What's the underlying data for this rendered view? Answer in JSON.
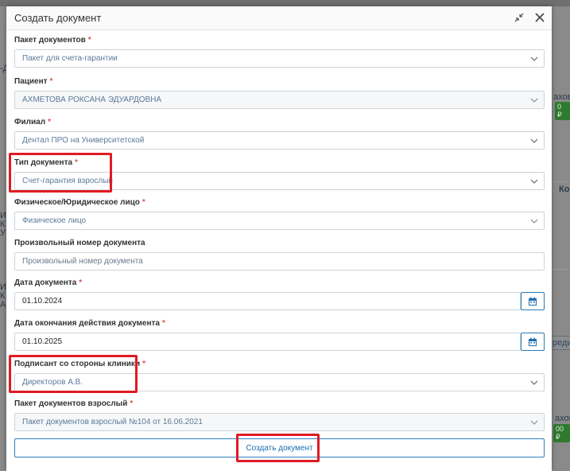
{
  "modal": {
    "title": "Создать документ"
  },
  "fields": {
    "doc_package": {
      "label": "Пакет документов",
      "value": "Пакет для счета-гарантии"
    },
    "patient": {
      "label": "Пациент",
      "value": "АХМЕТОВА РОКСАНА ЭДУАРДОВНА"
    },
    "branch": {
      "label": "Филиал",
      "value": "Дентал ПРО на Университетской"
    },
    "doc_type": {
      "label": "Тип документа",
      "value": "Счет-гарантия взрослый"
    },
    "person_type": {
      "label": "Физическое/Юридическое лицо",
      "value": "Физическое лицо"
    },
    "custom_number": {
      "label": "Произвольный номер документа",
      "placeholder": "Произвольный номер документа"
    },
    "doc_date": {
      "label": "Дата документа",
      "value": "01.10.2024"
    },
    "doc_end_date": {
      "label": "Дата окончания действия документа",
      "value": "01.10.2025"
    },
    "signer": {
      "label": "Подписант со стороны клиники",
      "value": "Директоров А.В."
    },
    "adult_package": {
      "label": "Пакет документов взрослый",
      "value": "Пакет документов взрослый №104 от 16.06.2021"
    }
  },
  "required_mark": "*",
  "submit_label": "Создать документ",
  "background": {
    "frag_1": "ахов ы",
    "frag_2": "0 ₽",
    "frag_3": "Ко",
    "frag_4": "редит",
    "frag_5": "ахов",
    "frag_6": "00 ₽",
    "frag_7": "ИВ",
    "frag_8": "К",
    "frag_9": "У",
    "frag_10": "ИВ",
    "frag_11": "К",
    "frag_12": "А",
    "frag_13": "-Д"
  },
  "colors": {
    "accent": "#2d7fc1",
    "highlight": "#e01b24",
    "required": "#d9534f"
  }
}
